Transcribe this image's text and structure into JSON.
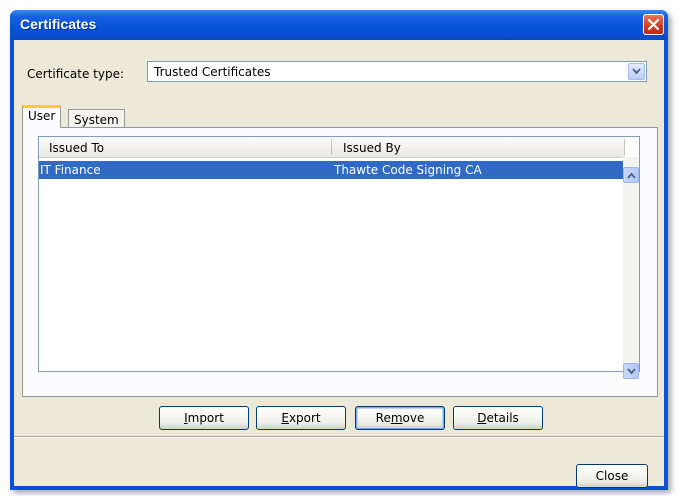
{
  "window": {
    "title": "Certificates"
  },
  "certificate_type": {
    "label": "Certificate type:",
    "selected": "Trusted Certificates"
  },
  "tabs": [
    {
      "label": "User",
      "active": true
    },
    {
      "label": "System",
      "active": false
    }
  ],
  "table": {
    "columns": [
      "Issued To",
      "Issued By"
    ],
    "rows": [
      {
        "issued_to": "IT Finance",
        "issued_by": "Thawte Code Signing CA",
        "selected": true
      }
    ]
  },
  "actions": {
    "import": {
      "pre": "",
      "key": "I",
      "post": "mport"
    },
    "export": {
      "pre": "",
      "key": "E",
      "post": "xport"
    },
    "remove": {
      "pre": "Re",
      "key": "m",
      "post": "ove"
    },
    "details": {
      "pre": "",
      "key": "D",
      "post": "etails"
    }
  },
  "footer": {
    "close_label": "Close"
  },
  "colors": {
    "title_bar": "#0a50d8",
    "selection": "#316ac5",
    "dialog_bg": "#ece9d8",
    "tab_highlight": "#ffc83c"
  }
}
